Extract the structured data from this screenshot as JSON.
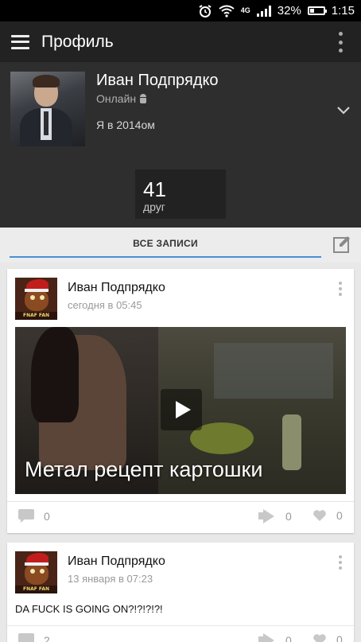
{
  "statusbar": {
    "battery_text": "32%",
    "battery_level": 0.32,
    "time": "1:15",
    "network": "4G"
  },
  "toolbar": {
    "title": "Профиль"
  },
  "profile": {
    "name": "Иван Подпрядко",
    "online": "Онлайн",
    "status": "Я в 2014ом",
    "friends_count": "41",
    "friends_label": "друг"
  },
  "tabs": {
    "all_posts": "ВСЕ ЗАПИСИ"
  },
  "posts": [
    {
      "author": "Иван Подпрядко",
      "time": "сегодня в 05:45",
      "video_title": "Метал рецепт картошки",
      "comments": "0",
      "reposts": "0",
      "likes": "0",
      "avatar_caption": "FNAF FAN group"
    },
    {
      "author": "Иван Подпрядко",
      "time": "13 января в 07:23",
      "text": "DA FUCK IS GOING ON?!?!?!?!",
      "comments": "2",
      "reposts": "0",
      "likes": "0",
      "avatar_caption": "FNAF FAN group"
    }
  ],
  "colors": {
    "accent": "#4a8fd6",
    "toolbar": "#222222",
    "header": "#2e2e2e"
  }
}
